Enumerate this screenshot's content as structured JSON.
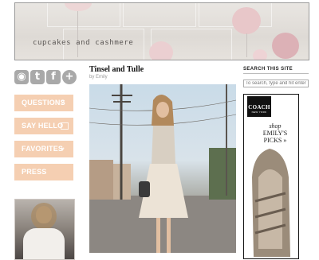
{
  "header": {
    "site_title": "cupcakes and cashmere"
  },
  "social": [
    {
      "name": "rss",
      "glyph": "◉",
      "color": "#a9a9a9"
    },
    {
      "name": "twitter",
      "glyph": "t",
      "color": "#a9a9a9"
    },
    {
      "name": "facebook",
      "glyph": "f",
      "color": "#a9a9a9"
    },
    {
      "name": "google-plus",
      "glyph": "+",
      "color": "#a9a9a9"
    }
  ],
  "nav": [
    {
      "label": "QUESTIONS"
    },
    {
      "label": "SAY HELLO"
    },
    {
      "label": "FAVORITES"
    },
    {
      "label": "PRESS"
    }
  ],
  "post": {
    "title": "Tinsel and Tulle",
    "byline": "by Emily"
  },
  "search": {
    "heading": "SEARCH THIS SITE",
    "placeholder": "To search, type and hit enter"
  },
  "ad": {
    "brand": "COACH",
    "city": "NEW YORK",
    "tagline_line1": "shop",
    "tagline_line2": "EMILY'S",
    "tagline_line3": "PICKS »"
  },
  "colors": {
    "accent": "#f5cfb2",
    "balloon": "#e8c7c9"
  }
}
